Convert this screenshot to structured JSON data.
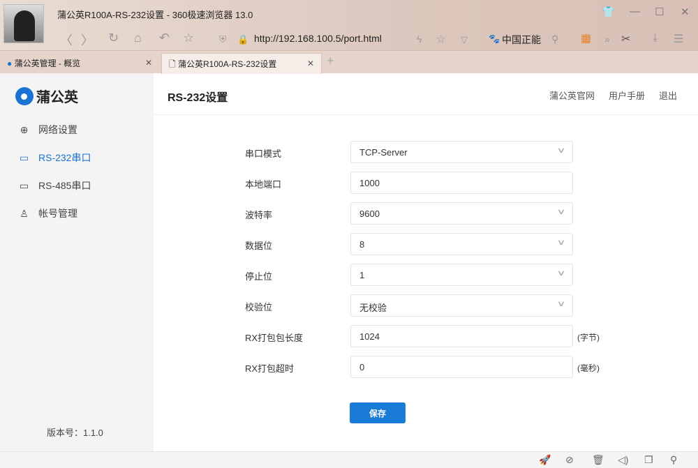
{
  "window": {
    "title": "蒲公英R100A-RS-232设置 - 360极速浏览器 13.0",
    "url": "http://192.168.100.5/port.html",
    "search_engine": "中国正能"
  },
  "tabs": [
    {
      "label": "蒲公英管理 - 概览"
    },
    {
      "label": "蒲公英R100A-RS-232设置"
    }
  ],
  "sidebar": {
    "brand": "蒲公英",
    "items": [
      {
        "label": "网络设置"
      },
      {
        "label": "RS-232串口"
      },
      {
        "label": "RS-485串口"
      },
      {
        "label": "帐号管理"
      }
    ],
    "version": "版本号：1.1.0"
  },
  "header": {
    "title": "RS-232设置",
    "links": [
      "蒲公英官网",
      "用户手册",
      "退出"
    ]
  },
  "form": [
    {
      "label": "串口模式",
      "value": "TCP-Server",
      "type": "select"
    },
    {
      "label": "本地端口",
      "value": "1000",
      "type": "input"
    },
    {
      "label": "波特率",
      "value": "9600",
      "type": "select"
    },
    {
      "label": "数据位",
      "value": "8",
      "type": "select"
    },
    {
      "label": "停止位",
      "value": "1",
      "type": "select"
    },
    {
      "label": "校验位",
      "value": "无校验",
      "type": "select"
    },
    {
      "label": "RX打包包长度",
      "value": "1024",
      "type": "input",
      "unit": "(字节)"
    },
    {
      "label": "RX打包超时",
      "value": "0",
      "type": "input",
      "unit": "(毫秒)"
    }
  ],
  "save_label": "保存",
  "accent": "#1a7bd6"
}
